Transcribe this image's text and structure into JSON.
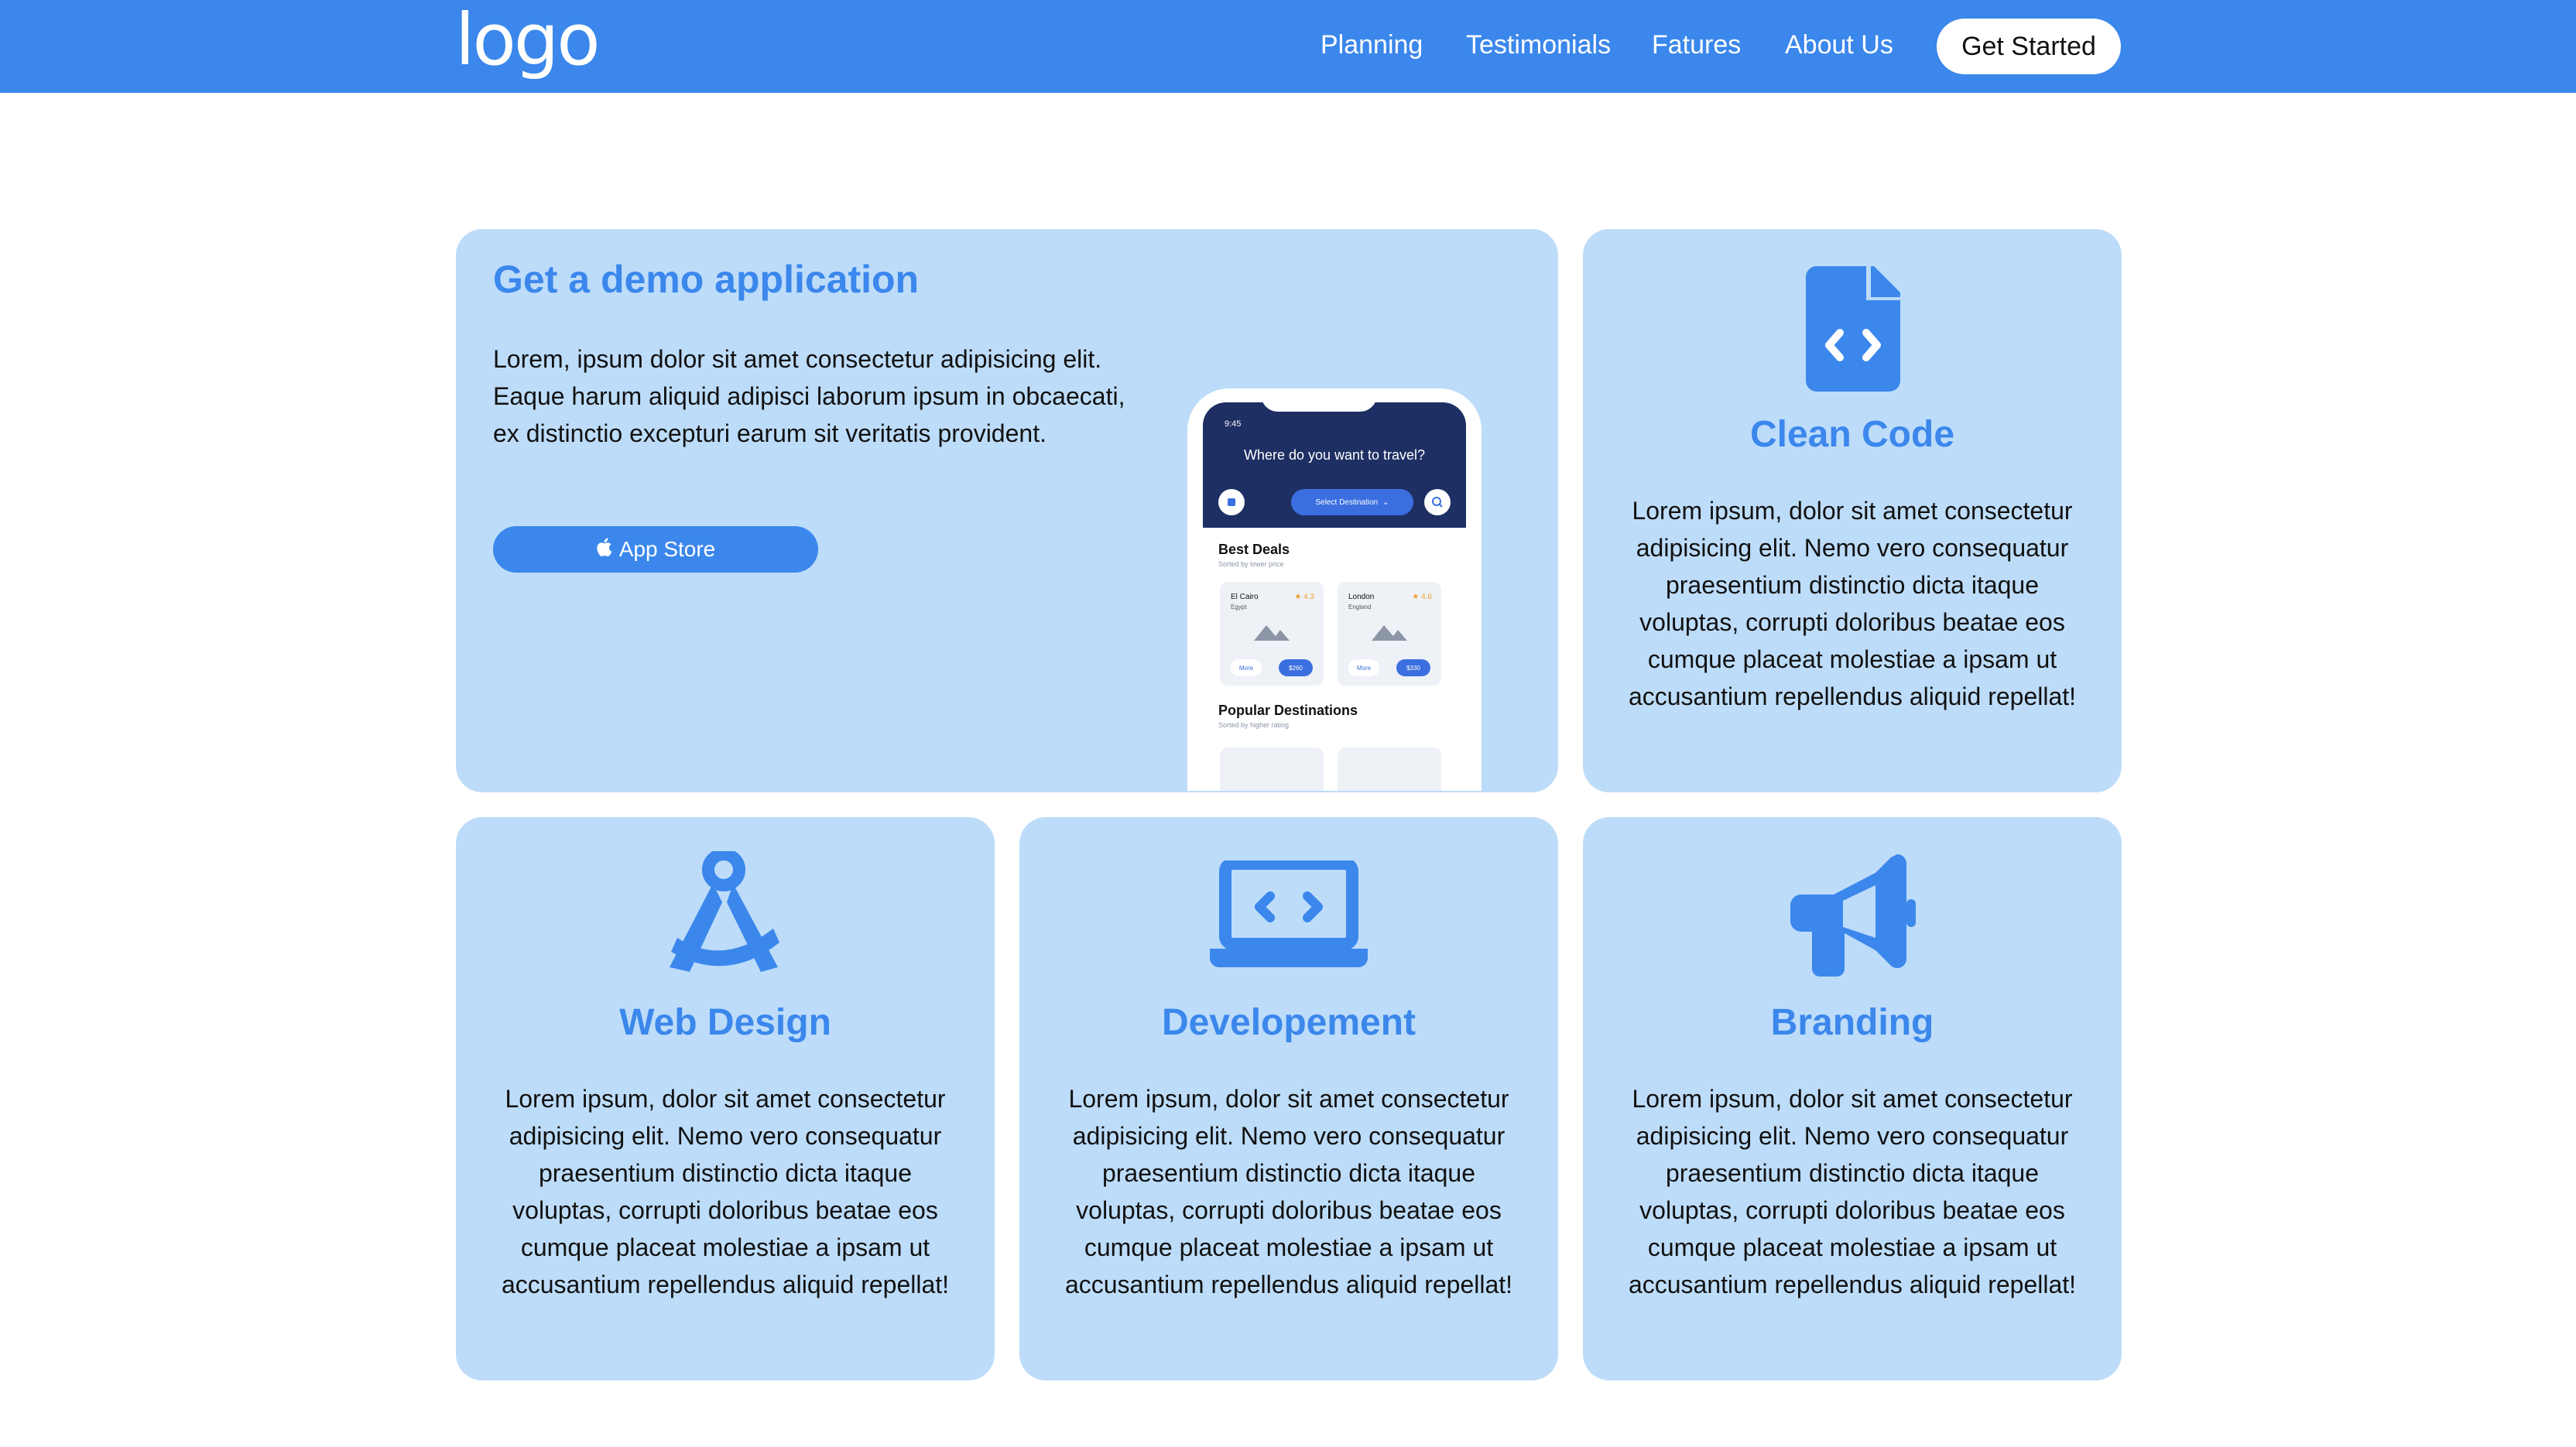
{
  "header": {
    "logo_text": "logo",
    "nav": [
      "Planning",
      "Testimonials",
      "Fatures",
      "About Us"
    ],
    "cta_label": "Get Started"
  },
  "demo": {
    "title": "Get a demo application",
    "text": "Lorem, ipsum dolor sit amet consectetur adipisicing elit. Eaque harum aliquid adipisci laborum ipsum in obcaecati, ex distinctio excepturi earum sit veritatis provident.",
    "button_label": "App Store",
    "phone": {
      "time": "9:45",
      "question": "Where do you want to travel?",
      "select_label": "Select Destination",
      "best_deals": "Best Deals",
      "best_deals_sub": "Sorted by lower price",
      "deals": [
        {
          "city": "El Cairo",
          "country": "Egypt",
          "rating": "4.3",
          "more": "More",
          "price": "$260"
        },
        {
          "city": "London",
          "country": "England",
          "rating": "4.6",
          "more": "More",
          "price": "$330"
        }
      ],
      "popular": "Popular Destinations",
      "popular_sub": "Sorted by higher rating"
    }
  },
  "cards": [
    {
      "title": "Clean Code",
      "icon": "code-file-icon",
      "text": "Lorem ipsum, dolor sit amet consectetur adipisicing elit. Nemo vero consequatur praesentium distinctio dicta itaque voluptas, corrupti doloribus beatae eos cumque placeat molestiae a ipsam ut accusantium repellendus aliquid repellat!"
    },
    {
      "title": "Web Design",
      "icon": "compass-drafting-icon",
      "text": "Lorem ipsum, dolor sit amet consectetur adipisicing elit. Nemo vero consequatur praesentium distinctio dicta itaque voluptas, corrupti doloribus beatae eos cumque placeat molestiae a ipsam ut accusantium repellendus aliquid repellat!"
    },
    {
      "title": "Developement",
      "icon": "laptop-code-icon",
      "text": "Lorem ipsum, dolor sit amet consectetur adipisicing elit. Nemo vero consequatur praesentium distinctio dicta itaque voluptas, corrupti doloribus beatae eos cumque placeat molestiae a ipsam ut accusantium repellendus aliquid repellat!"
    },
    {
      "title": "Branding",
      "icon": "megaphone-icon",
      "text": "Lorem ipsum, dolor sit amet consectetur adipisicing elit. Nemo vero consequatur praesentium distinctio dicta itaque voluptas, corrupti doloribus beatae eos cumque placeat molestiae a ipsam ut accusantium repellendus aliquid repellat!"
    }
  ],
  "colors": {
    "accent": "#3b87ec",
    "card_bg": "#bddcf9",
    "phone_header": "#1e2f63"
  }
}
